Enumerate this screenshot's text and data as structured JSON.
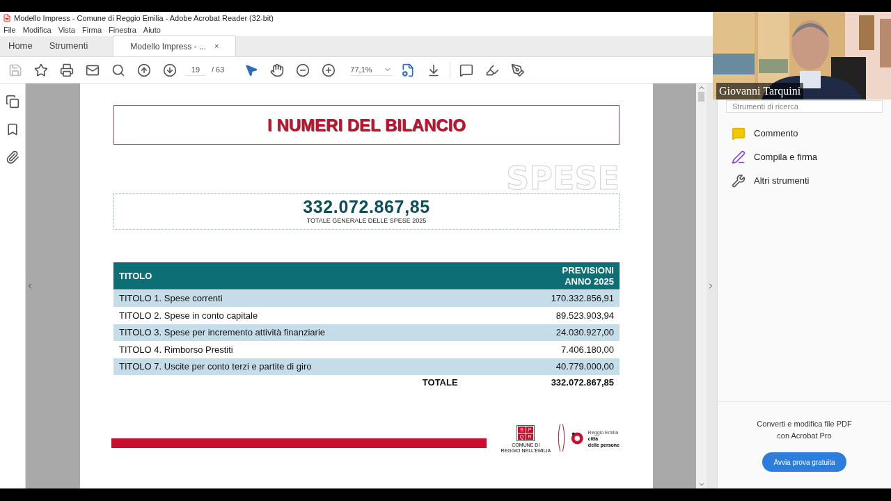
{
  "window": {
    "title": "Modello Impress - Comune di Reggio Emilia - Adobe Acrobat Reader (32-bit)"
  },
  "menu": [
    "File",
    "Modifica",
    "Vista",
    "Firma",
    "Finestra",
    "Aiuto"
  ],
  "tabs": [
    {
      "label": "Home",
      "selected": false
    },
    {
      "label": "Strumenti",
      "selected": false
    },
    {
      "label": "Modello Impress - ...",
      "selected": true,
      "close": "×"
    }
  ],
  "toolbar": {
    "page": "19",
    "total": "/ 63",
    "zoom": "77,1%"
  },
  "document": {
    "title": "I NUMERI DEL BILANCIO",
    "section": "SPESE",
    "total": "332.072.867,85",
    "total_label": "TOTALE GENERALE DELLE SPESE 2025",
    "table": {
      "columns": [
        "TITOLO",
        "PREVISIONI\nANNO 2025"
      ],
      "rows": [
        {
          "label": "TITOLO 1. Spese correnti",
          "value": "170.332.856,91"
        },
        {
          "label": "TITOLO 2. Spese in conto capitale",
          "value": "89.523.903,94"
        },
        {
          "label": "TITOLO 3. Spese per incremento attività finanziarie",
          "value": "24.030.927,00"
        },
        {
          "label": "TITOLO 4. Rimborso Prestiti",
          "value": "7.406.180,00"
        },
        {
          "label": "TITOLO 7. Uscite per conto terzi e partite di giro",
          "value": "40.779.000,00"
        }
      ],
      "total_label": "TOTALE",
      "total_value": "332.072.867,85"
    },
    "crest_letters": [
      "S",
      "P",
      "Q",
      "R"
    ],
    "crest_caption": "COMUNE DI\nREGGIO NELL'EMILIA",
    "brand": [
      "Reggio Emilia",
      "città",
      "delle persone"
    ]
  },
  "right_panel": {
    "search_placeholder": "Strumenti di ricerca",
    "tools": [
      {
        "label": "Commento",
        "kind": "comment"
      },
      {
        "label": "Compila e firma",
        "kind": "sign"
      },
      {
        "label": "Altri strumenti",
        "kind": "more"
      }
    ],
    "promo": "Converti e modifica file PDF\ncon Acrobat Pro",
    "promo_button": "Avvia prova gratuita"
  },
  "video": {
    "name": "Giovanni Tarquini"
  }
}
